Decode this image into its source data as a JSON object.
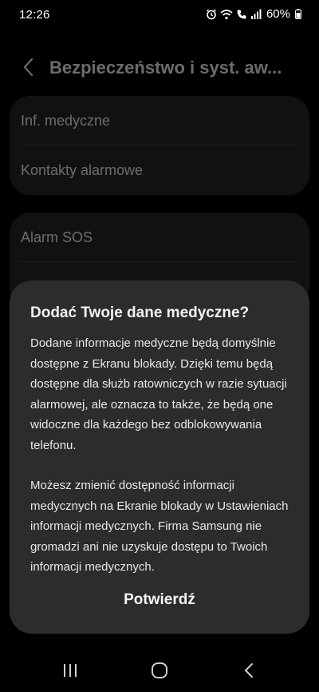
{
  "status_bar": {
    "time": "12:26",
    "battery": "60%",
    "icons": [
      "alarm-icon",
      "wifi-icon",
      "call-icon",
      "signal-icon",
      "battery-icon"
    ]
  },
  "header": {
    "title": "Bezpieczeństwo i syst. aw...",
    "back_icon": "chevron-left-icon"
  },
  "settings": {
    "items": [
      "Inf. medyczne",
      "Kontakty alarmowe",
      "Alarm SOS"
    ]
  },
  "dialog": {
    "title": "Dodać Twoje dane medyczne?",
    "body_p1": "Dodane informacje medyczne będą domyślnie dostępne z Ekranu blokady. Dzięki temu będą dostępne dla służb ratowniczych w razie sytuacji alarmowej, ale oznacza to także, że będą one widoczne dla każdego bez odblokowywania telefonu.",
    "body_p2": "Możesz zmienić dostępność informacji medycznych na Ekranie blokady w Ustawieniach informacji medycznych. Firma Samsung nie gromadzi ani nie uzyskuje dostępu to Twoich informacji medycznych.",
    "confirm_label": "Potwierdź"
  },
  "nav_bar": {
    "buttons": [
      "recents-icon",
      "home-icon",
      "back-icon"
    ]
  },
  "colors": {
    "background": "#000000",
    "card": "#2a2a2a",
    "dialog": "#2c2c2c",
    "text": "#ffffff"
  }
}
